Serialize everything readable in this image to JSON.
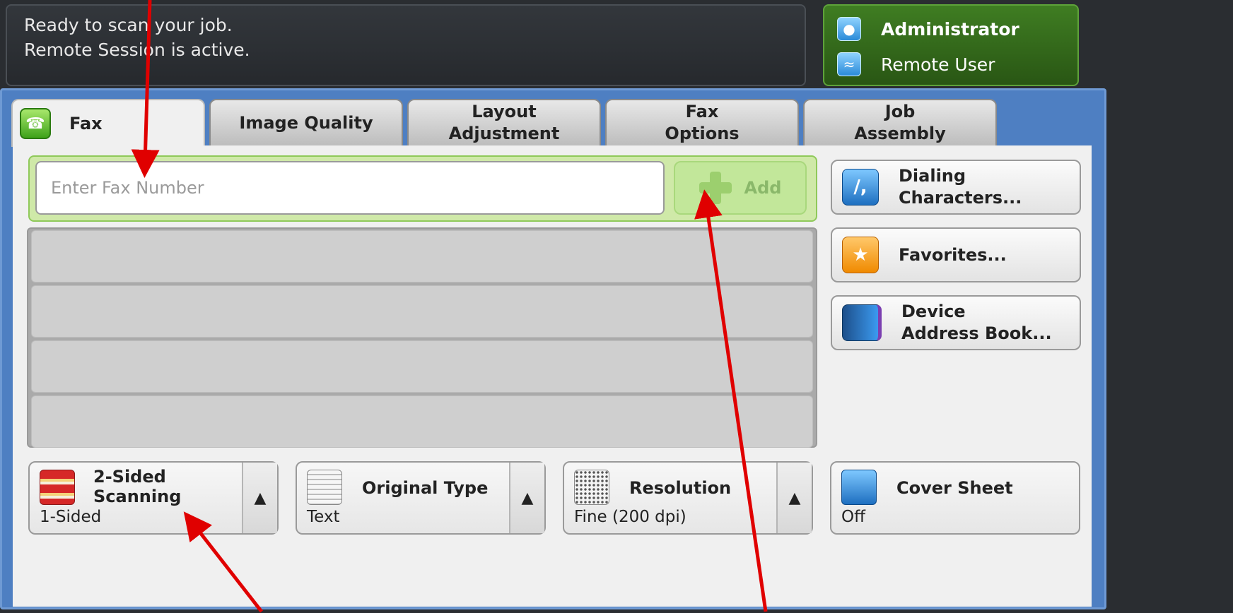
{
  "status": {
    "line1": "Ready to scan your job.",
    "line2": "Remote Session is active."
  },
  "user": {
    "name": "Administrator",
    "session": "Remote User"
  },
  "tabs": [
    {
      "label": "Fax"
    },
    {
      "label": "Image Quality"
    },
    {
      "label_line1": "Layout",
      "label_line2": "Adjustment"
    },
    {
      "label_line1": "Fax",
      "label_line2": "Options"
    },
    {
      "label_line1": "Job",
      "label_line2": "Assembly"
    }
  ],
  "fax_entry": {
    "placeholder": "Enter Fax Number",
    "add_label": "Add"
  },
  "side_buttons": [
    {
      "line1": "Dialing",
      "line2": "Characters...",
      "icon": "dialing-characters-icon"
    },
    {
      "line1": "Favorites...",
      "icon": "favorites-star-icon"
    },
    {
      "line1": "Device",
      "line2": "Address Book...",
      "icon": "address-book-icon"
    }
  ],
  "features": [
    {
      "title_line1": "2-Sided",
      "title_line2": "Scanning",
      "value": "1-Sided",
      "icon": "two-sided-icon"
    },
    {
      "title_line1": "Original Type",
      "value": "Text",
      "icon": "document-icon"
    },
    {
      "title_line1": "Resolution",
      "value": "Fine (200 dpi)",
      "icon": "resolution-grid-icon"
    },
    {
      "title_line1": "Cover Sheet",
      "value": "Off",
      "icon": "cover-sheet-icon"
    }
  ],
  "colors": {
    "accent_blue": "#4e7fc2",
    "user_green": "#3f7d22",
    "annotation_red": "#e00000"
  }
}
